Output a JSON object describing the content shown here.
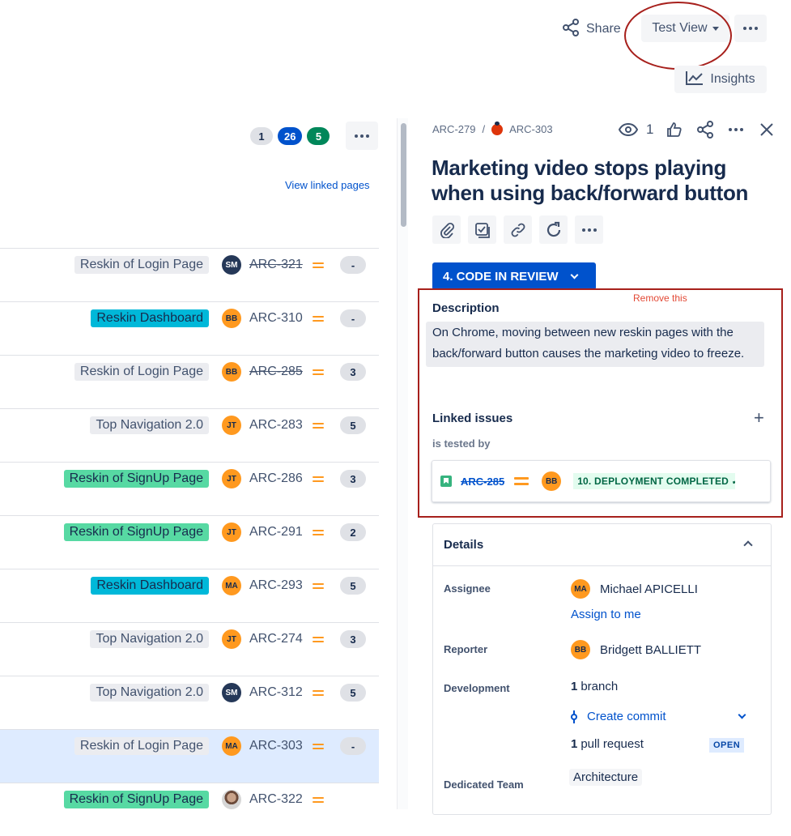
{
  "header": {
    "share_label": "Share",
    "view_label": "Test View",
    "insights_label": "Insights"
  },
  "list_header": {
    "counts": [
      "1",
      "26",
      "5"
    ],
    "view_linked_pages": "View linked pages"
  },
  "rows": [
    {
      "epic": "Reskin of Login Page",
      "epic_color": "grey",
      "avatar": "SM",
      "avatar_color": "navy",
      "key": "ARC-321",
      "done": true,
      "estimate": "-"
    },
    {
      "epic": "Reskin Dashboard",
      "epic_color": "cyan",
      "avatar": "BB",
      "avatar_color": "orange",
      "key": "ARC-310",
      "done": false,
      "estimate": "-"
    },
    {
      "epic": "Reskin of Login Page",
      "epic_color": "grey",
      "avatar": "BB",
      "avatar_color": "orange",
      "key": "ARC-285",
      "done": true,
      "estimate": "3"
    },
    {
      "epic": "Top Navigation 2.0",
      "epic_color": "grey",
      "avatar": "JT",
      "avatar_color": "orange",
      "key": "ARC-283",
      "done": false,
      "estimate": "5"
    },
    {
      "epic": "Reskin of SignUp Page",
      "epic_color": "green",
      "avatar": "JT",
      "avatar_color": "orange",
      "key": "ARC-286",
      "done": false,
      "estimate": "3"
    },
    {
      "epic": "Reskin of SignUp Page",
      "epic_color": "green",
      "avatar": "JT",
      "avatar_color": "orange",
      "key": "ARC-291",
      "done": false,
      "estimate": "2"
    },
    {
      "epic": "Reskin Dashboard",
      "epic_color": "cyan",
      "avatar": "MA",
      "avatar_color": "orange",
      "key": "ARC-293",
      "done": false,
      "estimate": "5"
    },
    {
      "epic": "Top Navigation 2.0",
      "epic_color": "grey",
      "avatar": "JT",
      "avatar_color": "orange",
      "key": "ARC-274",
      "done": false,
      "estimate": "3"
    },
    {
      "epic": "Top Navigation 2.0",
      "epic_color": "grey",
      "avatar": "SM",
      "avatar_color": "navy",
      "key": "ARC-312",
      "done": false,
      "estimate": "5"
    },
    {
      "epic": "Reskin of Login Page",
      "epic_color": "grey",
      "avatar": "MA",
      "avatar_color": "orange",
      "key": "ARC-303",
      "done": false,
      "estimate": "-",
      "selected": true
    },
    {
      "epic": "Reskin of SignUp Page",
      "epic_color": "green",
      "avatar": "",
      "avatar_color": "photo",
      "key": "ARC-322",
      "done": false,
      "estimate": ""
    }
  ],
  "issue": {
    "parent_key": "ARC-279",
    "key": "ARC-303",
    "watchers": "1",
    "title": "Marketing video stops playing when using back/forward button",
    "status": "4. CODE IN REVIEW",
    "annotation": "Remove this",
    "description_heading": "Description",
    "description": "On Chrome, moving between new reskin pages with the back/forward button causes the marketing video to freeze.",
    "linked_heading": "Linked issues",
    "relation": "is tested by",
    "linked": {
      "key": "ARC-285",
      "avatar": "BB",
      "status": "10. DEPLOYMENT COMPLETED ✓"
    }
  },
  "details": {
    "heading": "Details",
    "assignee_label": "Assignee",
    "assignee_initials": "MA",
    "assignee_name": "Michael APICELLI",
    "assign_to_me": "Assign to me",
    "reporter_label": "Reporter",
    "reporter_initials": "BB",
    "reporter_name": "Bridgett BALLIETT",
    "development_label": "Development",
    "branch_count": "1",
    "branch_text": "branch",
    "create_commit": "Create commit",
    "pr_count": "1",
    "pr_text": "pull request",
    "pr_status": "OPEN",
    "team_label": "Dedicated Team",
    "team_value": "Architecture"
  }
}
